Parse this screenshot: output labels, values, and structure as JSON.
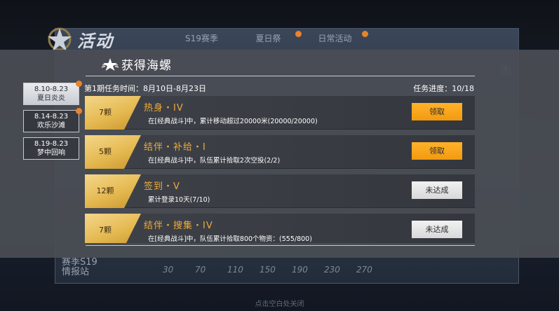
{
  "background": {
    "title": "活动",
    "tabs": [
      "S19赛季",
      "夏日祭",
      "日常活动"
    ],
    "ticks": [
      "30",
      "70",
      "110",
      "150",
      "190",
      "230",
      "270"
    ],
    "station_line1": "赛季S19",
    "station_line2": "情报站",
    "close_hint": "点击空白处关闭",
    "help_icon": "?"
  },
  "modal": {
    "title": "获得海螺",
    "period_label": "第1期任务时间：8月10日-8月23日",
    "progress_label": "任务进度：10/18",
    "side_tabs": [
      {
        "line1": "8.10-8.23",
        "line2": "夏日炎炎"
      },
      {
        "line1": "8.14-8.23",
        "line2": "欢乐沙滩"
      },
      {
        "line1": "8.19-8.23",
        "line2": "梦中回响"
      }
    ],
    "tasks": [
      {
        "reward": "7颗",
        "name": "热身・IV",
        "desc": "在[经典战斗]中，累计移动超过20000米(20000/20000)",
        "button": "领取"
      },
      {
        "reward": "5颗",
        "name": "结伴・补给・I",
        "desc": "在[经典战斗]中，队伍累计拾取2次空投(2/2)",
        "button": "领取"
      },
      {
        "reward": "12颗",
        "name": "签到・V",
        "desc": "累计登录10天(7/10)",
        "button": "未达成"
      },
      {
        "reward": "7颗",
        "name": "结伴・搜集・IV",
        "desc": "在[经典战斗]中，队伍累计拾取800个物资：(555/800)",
        "button": "未达成"
      }
    ]
  },
  "colors": {
    "accent_orange": "#f2a93a",
    "claim_button": "#f29a10",
    "reward_gold": "#e5b951",
    "notify_dot": "#e9832c"
  }
}
